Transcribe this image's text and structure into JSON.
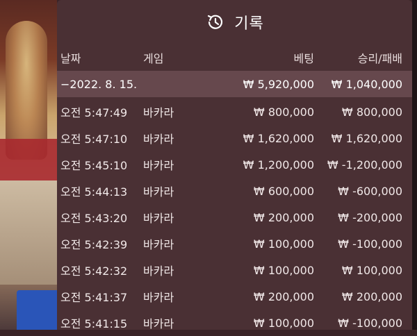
{
  "header": {
    "title": "기록",
    "icon": "history-clock-icon"
  },
  "columns": {
    "date": "날짜",
    "game": "게임",
    "bet": "베팅",
    "result": "승리/패배"
  },
  "summary": {
    "date": "−2022. 8. 15.",
    "bet": "₩ 5,920,000",
    "result": "₩ 1,040,000"
  },
  "rows": [
    {
      "time": "오전 5:47:49",
      "game": "바카라",
      "bet": "₩ 800,000",
      "result": "₩ 800,000"
    },
    {
      "time": "오전 5:47:10",
      "game": "바카라",
      "bet": "₩ 1,620,000",
      "result": "₩ 1,620,000"
    },
    {
      "time": "오전 5:45:10",
      "game": "바카라",
      "bet": "₩ 1,200,000",
      "result": "₩ -1,200,000"
    },
    {
      "time": "오전 5:44:13",
      "game": "바카라",
      "bet": "₩ 600,000",
      "result": "₩ -600,000"
    },
    {
      "time": "오전 5:43:20",
      "game": "바카라",
      "bet": "₩ 200,000",
      "result": "₩ -200,000"
    },
    {
      "time": "오전 5:42:39",
      "game": "바카라",
      "bet": "₩ 100,000",
      "result": "₩ -100,000"
    },
    {
      "time": "오전 5:42:32",
      "game": "바카라",
      "bet": "₩ 100,000",
      "result": "₩ 100,000"
    },
    {
      "time": "오전 5:41:37",
      "game": "바카라",
      "bet": "₩ 200,000",
      "result": "₩ 200,000"
    },
    {
      "time": "오전 5:41:15",
      "game": "바카라",
      "bet": "₩ 100,000",
      "result": "₩ -100,000"
    }
  ]
}
